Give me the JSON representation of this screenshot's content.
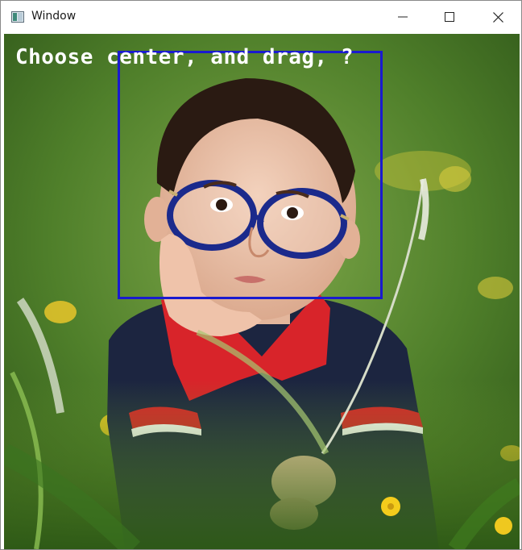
{
  "window": {
    "title": "Window",
    "app_icon": "window-app-icon",
    "controls": [
      "minimize-icon",
      "maximize-icon",
      "close-icon"
    ]
  },
  "canvas": {
    "overlay_text": "Choose center, and drag, ?",
    "overlay_text_color": "#ffffff",
    "selection_color": "#1a1acf",
    "image_subject": "boy-with-glasses-in-grass-photo"
  }
}
